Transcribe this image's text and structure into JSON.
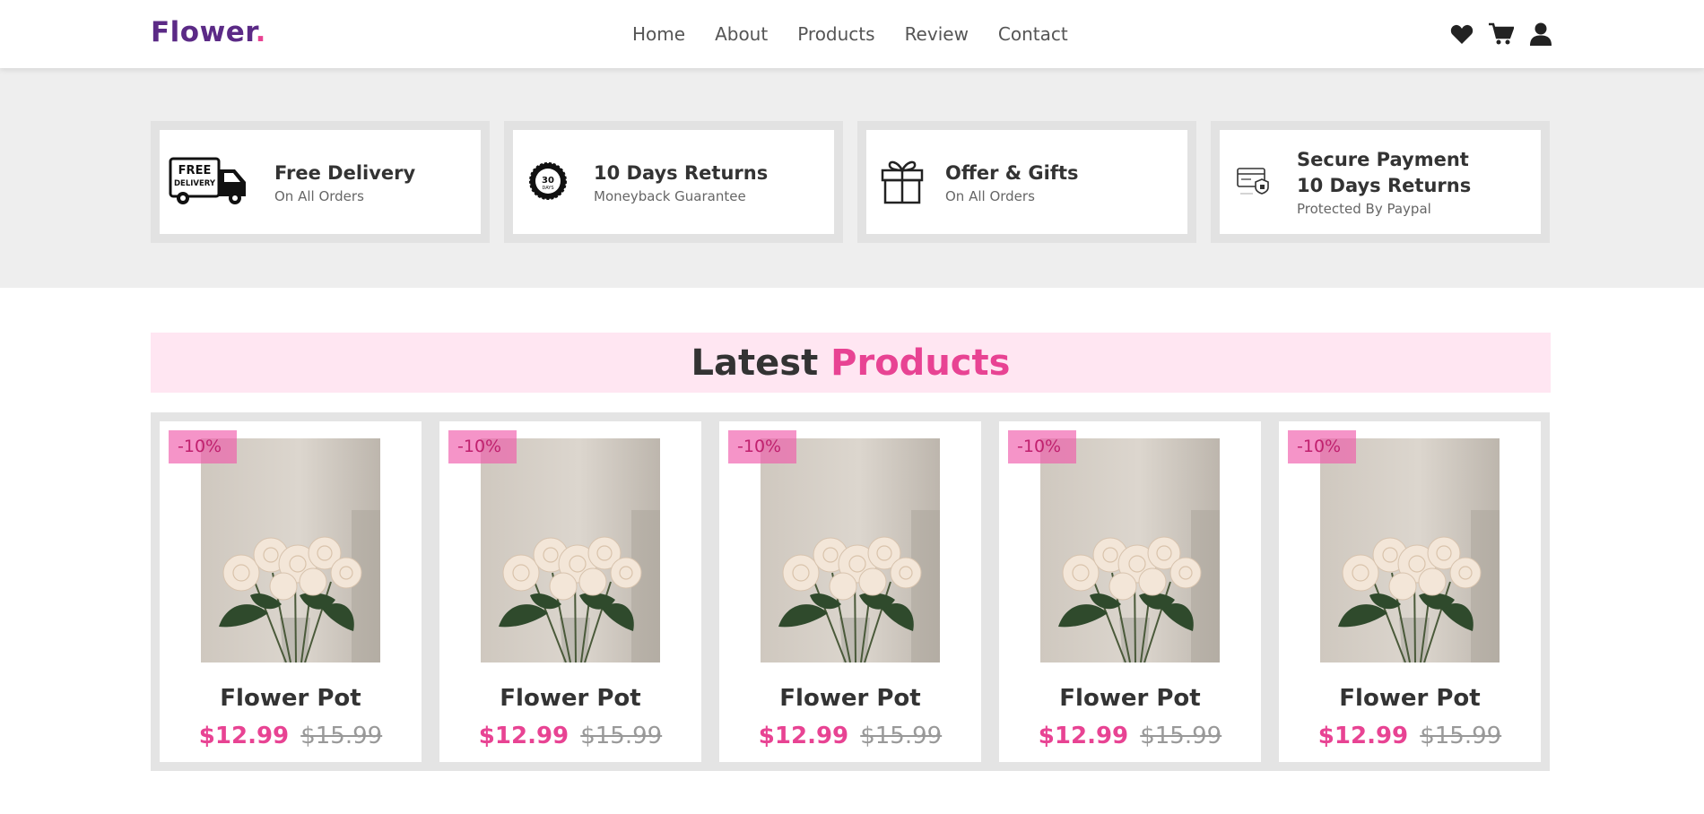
{
  "brand": {
    "name": "Flower",
    "dot": "."
  },
  "nav": {
    "items": [
      "Home",
      "About",
      "Products",
      "Review",
      "Contact"
    ]
  },
  "header_icons": [
    "heart-icon",
    "cart-icon",
    "user-icon"
  ],
  "features": [
    {
      "icon": "free-delivery-truck-icon",
      "icon_text": [
        "FREE",
        "DELIVERY"
      ],
      "title": "Free Delivery",
      "subtitle": "On All Orders"
    },
    {
      "icon": "30-days-seal-icon",
      "icon_text": [
        "30",
        "DAYS"
      ],
      "title": "10 Days Returns",
      "subtitle": "Moneyback Guarantee"
    },
    {
      "icon": "gift-icon",
      "title": "Offer & Gifts",
      "subtitle": "On All Orders"
    },
    {
      "icon": "secure-card-icon",
      "title_lines": [
        "Secure Payment",
        "10 Days Returns"
      ],
      "subtitle": "Protected By Paypal"
    }
  ],
  "section": {
    "title": "Latest",
    "title_accent": "Products"
  },
  "products": [
    {
      "badge": "-10%",
      "name": "Flower Pot",
      "price": "$12.99",
      "old_price": "$15.99"
    },
    {
      "badge": "-10%",
      "name": "Flower Pot",
      "price": "$12.99",
      "old_price": "$15.99"
    },
    {
      "badge": "-10%",
      "name": "Flower Pot",
      "price": "$12.99",
      "old_price": "$15.99"
    },
    {
      "badge": "-10%",
      "name": "Flower Pot",
      "price": "$12.99",
      "old_price": "$15.99"
    },
    {
      "badge": "-10%",
      "name": "Flower Pot",
      "price": "$12.99",
      "old_price": "$15.99"
    }
  ],
  "colors": {
    "brand": "#5b2a86",
    "accent": "#e84393",
    "band": "#eeeeee",
    "title_bg": "#ffe6f2"
  }
}
